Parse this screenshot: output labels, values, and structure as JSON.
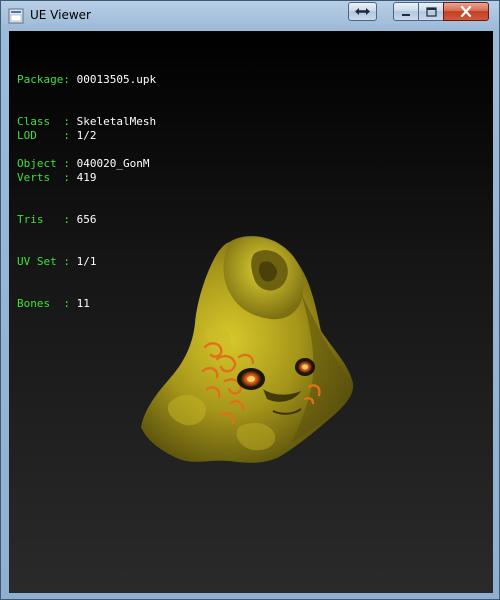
{
  "window": {
    "title": "UE Viewer"
  },
  "info": {
    "package_key": "Package:",
    "package_value": "00013505.upk",
    "class_key": "Class  :",
    "class_value": "SkeletalMesh",
    "object_key": "Object :",
    "object_value": "040020_GonM",
    "lod_key": "LOD    :",
    "lod_value": "1/2",
    "verts_key": "Verts  :",
    "verts_value": "419",
    "tris_key": "Tris   :",
    "tris_value": "656",
    "uvset_key": "UV Set :",
    "uvset_value": "1/1",
    "bones_key": "Bones  :",
    "bones_value": "11"
  },
  "colors": {
    "label_green": "#3fe03f",
    "value_white": "#ffffff",
    "mesh_yellow": "#b8a81a",
    "mesh_orange": "#e0701a"
  },
  "icons": {
    "app": "ue-viewer-app-icon",
    "restore_arrows": "double-arrow-icon",
    "minimize": "minimize-icon",
    "maximize": "maximize-icon",
    "close": "close-icon"
  }
}
